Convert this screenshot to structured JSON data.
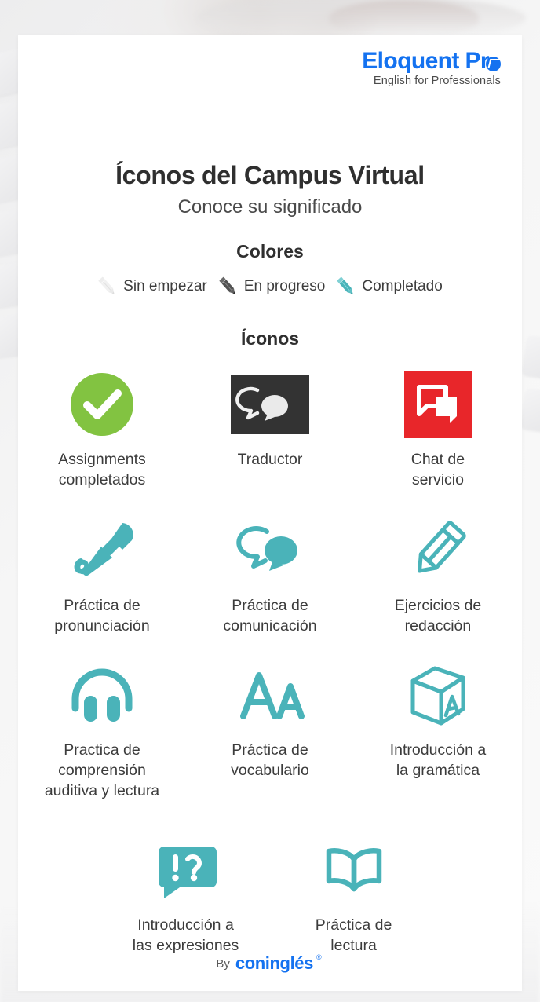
{
  "brand": {
    "name": "Eloquent Pro",
    "name_main": "Eloquent Pr",
    "tagline": "English for Professionals",
    "color": "#1472f0",
    "bubble_icon": "speech-bubble-icon"
  },
  "header": {
    "title": "Íconos del Campus Virtual",
    "subtitle": "Conoce su significado"
  },
  "sections": {
    "colors_title": "Colores",
    "icons_title": "Íconos"
  },
  "legend": {
    "items": [
      {
        "label": "Sin empezar",
        "icon": "pencil-icon",
        "color": "#e2e2e2"
      },
      {
        "label": "En progreso",
        "icon": "pencil-icon",
        "color": "#4a4a4a"
      },
      {
        "label": "Completado",
        "icon": "pencil-icon",
        "color": "#4ab3b9"
      }
    ]
  },
  "icons": [
    {
      "label": "Assignments\ncompletados",
      "icon": "check-circle-icon",
      "color": "#82c341"
    },
    {
      "label": "Traductor",
      "icon": "translator-bubbles-icon",
      "color": "#333333"
    },
    {
      "label": "Chat de\nservicio",
      "icon": "chat-support-icon",
      "color": "#e8262a"
    },
    {
      "label": "Práctica de\npronunciación",
      "icon": "microphone-icon",
      "color": "#4ab3b9"
    },
    {
      "label": "Práctica de\ncomunicación",
      "icon": "speech-bubbles-icon",
      "color": "#4ab3b9"
    },
    {
      "label": "Ejercicios de\nredacción",
      "icon": "pencil-icon",
      "color": "#4ab3b9"
    },
    {
      "label": "Practica de\ncomprensión\nauditiva y lectura",
      "icon": "headphones-icon",
      "color": "#4ab3b9"
    },
    {
      "label": "Práctica de\nvocabulario",
      "icon": "letters-aa-icon",
      "color": "#4ab3b9"
    },
    {
      "label": "Introducción a\nla gramática",
      "icon": "alphabet-block-icon",
      "color": "#4ab3b9"
    },
    {
      "label": "Introducción a\nlas expresiones",
      "icon": "exclamation-question-bubble-icon",
      "color": "#4ab3b9"
    },
    {
      "label": "Práctica de\nlectura",
      "icon": "open-book-icon",
      "color": "#4ab3b9"
    }
  ],
  "footer": {
    "by": "By",
    "brand": "coninglés",
    "registered": "®",
    "color": "#1472f0"
  },
  "palette": {
    "teal": "#4ab3b9",
    "green": "#82c341",
    "red": "#e8262a",
    "dark": "#333333",
    "blue": "#1472f0",
    "card": "#ffffff",
    "page": "#f2f2f3"
  }
}
